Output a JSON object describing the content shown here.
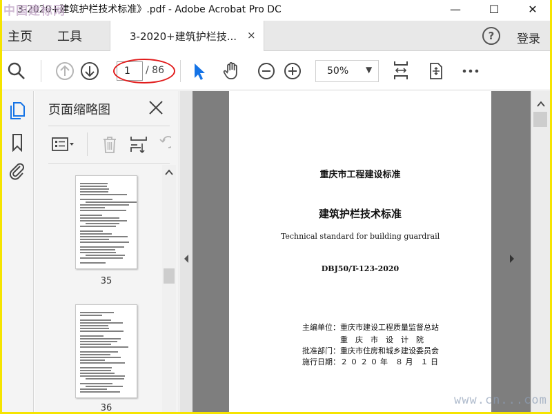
{
  "window": {
    "watermark_logo": "中国建标网",
    "title": "3-2020+建筑护栏技术标准》.pdf - Adobe Acrobat Pro DC",
    "minimize_glyph": "—",
    "maximize_glyph": "☐",
    "close_glyph": "✕"
  },
  "menubar": {
    "home_label": "主页",
    "tools_label": "工具",
    "tab_label": "3-2020+建筑护栏技...",
    "tab_close_glyph": "×",
    "help_glyph": "?",
    "login_label": "登录"
  },
  "toolbar": {
    "current_page": "1",
    "total_pages": "/ 86",
    "zoom": "50%",
    "zoom_caret": "▼",
    "icons": [
      "search-icon",
      "page-up-icon",
      "page-down-icon",
      "select-cursor-icon",
      "hand-tool-icon",
      "zoom-out-icon",
      "zoom-in-icon",
      "fit-page-icon",
      "full-screen-icon",
      "more-icon"
    ],
    "highlight_color": "#e11b1b",
    "accent_color": "#1473e6"
  },
  "left_rail": {
    "icons": [
      "page-thumbnails-icon",
      "bookmark-icon",
      "attachment-icon"
    ]
  },
  "thumbnail_panel": {
    "title": "页面缩略图",
    "close_glyph": "×",
    "icons": [
      "thumbnail-options-icon",
      "delete-page-icon",
      "insert-page-icon",
      "undo-icon"
    ],
    "thumbnails": [
      {
        "label": "35"
      },
      {
        "label": "36"
      }
    ]
  },
  "document": {
    "line1": "重庆市工程建设标准",
    "line2": "建筑护栏技术标准",
    "line3": "Technical standard for building guardrail",
    "line4": "DBJ50/T-123-2020",
    "info": [
      "主编单位：重庆市建设工程质量监督总站",
      "　　　　　重　庆　市　设　计　院",
      "批准部门：重庆市住房和城乡建设委员会",
      "施行日期：２ ０ ２ ０ 年　８ 月　１ 日"
    ]
  },
  "watermark_url": "www.cn...com"
}
